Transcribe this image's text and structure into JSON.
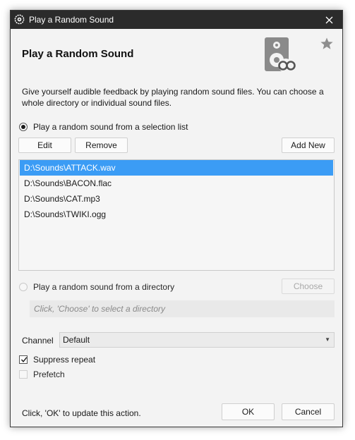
{
  "window": {
    "title": "Play a Random Sound"
  },
  "header": {
    "heading": "Play a Random Sound",
    "icon": "speaker-loop-icon",
    "favorite_icon": "star-icon"
  },
  "description": "Give yourself audible feedback by playing random sound files.  You can choose a whole directory or individual sound files.",
  "selection_mode": {
    "label": "Play a random sound from a selection list",
    "checked": true,
    "buttons": {
      "edit": "Edit",
      "remove": "Remove",
      "add_new": "Add New"
    },
    "files": [
      {
        "path": "D:\\Sounds\\ATTACK.wav",
        "selected": true
      },
      {
        "path": "D:\\Sounds\\BACON.flac",
        "selected": false
      },
      {
        "path": "D:\\Sounds\\CAT.mp3",
        "selected": false
      },
      {
        "path": "D:\\Sounds\\TWIKI.ogg",
        "selected": false
      }
    ]
  },
  "directory_mode": {
    "label": "Play a random sound from a directory",
    "checked": false,
    "choose_label": "Choose",
    "placeholder": "Click, 'Choose' to select a directory"
  },
  "channel": {
    "label": "Channel",
    "value": "Default"
  },
  "options": {
    "suppress_repeat": {
      "label": "Suppress repeat",
      "checked": true
    },
    "prefetch": {
      "label": "Prefetch",
      "checked": false
    }
  },
  "footer": {
    "hint": "Click, 'OK' to update this action.",
    "ok": "OK",
    "cancel": "Cancel"
  },
  "colors": {
    "titlebar": "#2b2b2b",
    "selection": "#3b9cf5",
    "background": "#f3f3f3"
  }
}
